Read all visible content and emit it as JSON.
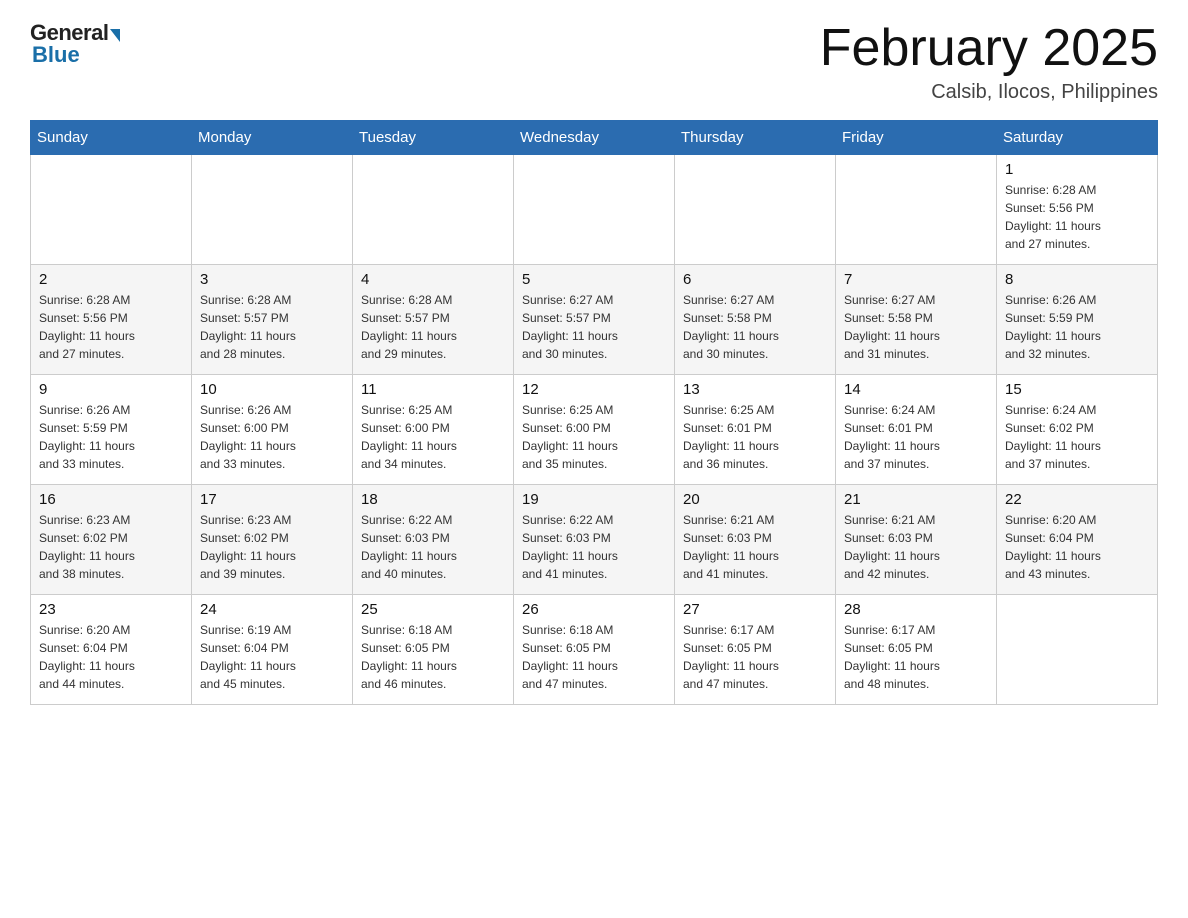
{
  "header": {
    "logo_general": "General",
    "logo_blue": "Blue",
    "month_title": "February 2025",
    "location": "Calsib, Ilocos, Philippines"
  },
  "weekdays": [
    "Sunday",
    "Monday",
    "Tuesday",
    "Wednesday",
    "Thursday",
    "Friday",
    "Saturday"
  ],
  "weeks": [
    [
      {
        "day": "",
        "info": ""
      },
      {
        "day": "",
        "info": ""
      },
      {
        "day": "",
        "info": ""
      },
      {
        "day": "",
        "info": ""
      },
      {
        "day": "",
        "info": ""
      },
      {
        "day": "",
        "info": ""
      },
      {
        "day": "1",
        "info": "Sunrise: 6:28 AM\nSunset: 5:56 PM\nDaylight: 11 hours\nand 27 minutes."
      }
    ],
    [
      {
        "day": "2",
        "info": "Sunrise: 6:28 AM\nSunset: 5:56 PM\nDaylight: 11 hours\nand 27 minutes."
      },
      {
        "day": "3",
        "info": "Sunrise: 6:28 AM\nSunset: 5:57 PM\nDaylight: 11 hours\nand 28 minutes."
      },
      {
        "day": "4",
        "info": "Sunrise: 6:28 AM\nSunset: 5:57 PM\nDaylight: 11 hours\nand 29 minutes."
      },
      {
        "day": "5",
        "info": "Sunrise: 6:27 AM\nSunset: 5:57 PM\nDaylight: 11 hours\nand 30 minutes."
      },
      {
        "day": "6",
        "info": "Sunrise: 6:27 AM\nSunset: 5:58 PM\nDaylight: 11 hours\nand 30 minutes."
      },
      {
        "day": "7",
        "info": "Sunrise: 6:27 AM\nSunset: 5:58 PM\nDaylight: 11 hours\nand 31 minutes."
      },
      {
        "day": "8",
        "info": "Sunrise: 6:26 AM\nSunset: 5:59 PM\nDaylight: 11 hours\nand 32 minutes."
      }
    ],
    [
      {
        "day": "9",
        "info": "Sunrise: 6:26 AM\nSunset: 5:59 PM\nDaylight: 11 hours\nand 33 minutes."
      },
      {
        "day": "10",
        "info": "Sunrise: 6:26 AM\nSunset: 6:00 PM\nDaylight: 11 hours\nand 33 minutes."
      },
      {
        "day": "11",
        "info": "Sunrise: 6:25 AM\nSunset: 6:00 PM\nDaylight: 11 hours\nand 34 minutes."
      },
      {
        "day": "12",
        "info": "Sunrise: 6:25 AM\nSunset: 6:00 PM\nDaylight: 11 hours\nand 35 minutes."
      },
      {
        "day": "13",
        "info": "Sunrise: 6:25 AM\nSunset: 6:01 PM\nDaylight: 11 hours\nand 36 minutes."
      },
      {
        "day": "14",
        "info": "Sunrise: 6:24 AM\nSunset: 6:01 PM\nDaylight: 11 hours\nand 37 minutes."
      },
      {
        "day": "15",
        "info": "Sunrise: 6:24 AM\nSunset: 6:02 PM\nDaylight: 11 hours\nand 37 minutes."
      }
    ],
    [
      {
        "day": "16",
        "info": "Sunrise: 6:23 AM\nSunset: 6:02 PM\nDaylight: 11 hours\nand 38 minutes."
      },
      {
        "day": "17",
        "info": "Sunrise: 6:23 AM\nSunset: 6:02 PM\nDaylight: 11 hours\nand 39 minutes."
      },
      {
        "day": "18",
        "info": "Sunrise: 6:22 AM\nSunset: 6:03 PM\nDaylight: 11 hours\nand 40 minutes."
      },
      {
        "day": "19",
        "info": "Sunrise: 6:22 AM\nSunset: 6:03 PM\nDaylight: 11 hours\nand 41 minutes."
      },
      {
        "day": "20",
        "info": "Sunrise: 6:21 AM\nSunset: 6:03 PM\nDaylight: 11 hours\nand 41 minutes."
      },
      {
        "day": "21",
        "info": "Sunrise: 6:21 AM\nSunset: 6:03 PM\nDaylight: 11 hours\nand 42 minutes."
      },
      {
        "day": "22",
        "info": "Sunrise: 6:20 AM\nSunset: 6:04 PM\nDaylight: 11 hours\nand 43 minutes."
      }
    ],
    [
      {
        "day": "23",
        "info": "Sunrise: 6:20 AM\nSunset: 6:04 PM\nDaylight: 11 hours\nand 44 minutes."
      },
      {
        "day": "24",
        "info": "Sunrise: 6:19 AM\nSunset: 6:04 PM\nDaylight: 11 hours\nand 45 minutes."
      },
      {
        "day": "25",
        "info": "Sunrise: 6:18 AM\nSunset: 6:05 PM\nDaylight: 11 hours\nand 46 minutes."
      },
      {
        "day": "26",
        "info": "Sunrise: 6:18 AM\nSunset: 6:05 PM\nDaylight: 11 hours\nand 47 minutes."
      },
      {
        "day": "27",
        "info": "Sunrise: 6:17 AM\nSunset: 6:05 PM\nDaylight: 11 hours\nand 47 minutes."
      },
      {
        "day": "28",
        "info": "Sunrise: 6:17 AM\nSunset: 6:05 PM\nDaylight: 11 hours\nand 48 minutes."
      },
      {
        "day": "",
        "info": ""
      }
    ]
  ]
}
